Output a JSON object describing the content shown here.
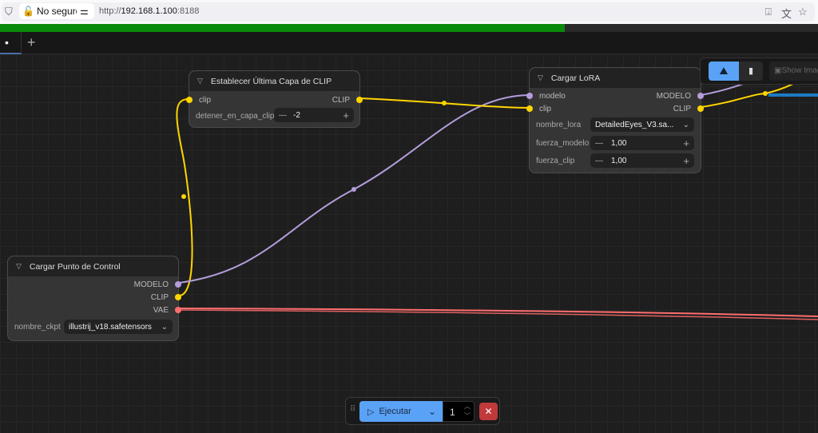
{
  "browser": {
    "security_label": "No seguro",
    "url_prefix": "http://",
    "url_host": "192.168.1.100",
    "url_port": ":8188"
  },
  "progress": {
    "percent": 69
  },
  "tabs": {
    "active_label": "•",
    "add_label": "+"
  },
  "nodes": {
    "clip_layer": {
      "title": "Establecer Última Capa de CLIP",
      "input": "clip",
      "output": "CLIP",
      "widget_label": "detener_en_capa_clip",
      "widget_value": "-2"
    },
    "lora": {
      "title": "Cargar LoRA",
      "inputs": [
        "modelo",
        "clip"
      ],
      "outputs": [
        "MODELO",
        "CLIP"
      ],
      "lora_label": "nombre_lora",
      "lora_value": "DetailedEyes_V3.sa...",
      "model_label": "fuerza_modelo",
      "model_value": "1,00",
      "clip_label": "fuerza_clip",
      "clip_value": "1,00"
    },
    "checkpoint": {
      "title": "Cargar Punto de Control",
      "outputs": [
        "MODELO",
        "CLIP",
        "VAE"
      ],
      "ckpt_label": "nombre_ckpt",
      "ckpt_value": "illustrij_v18.safetensors"
    }
  },
  "top_toolbar": {
    "show_image_label": "Show Image"
  },
  "run_bar": {
    "run_label": "Ejecutar",
    "batch_count": "1"
  },
  "colors": {
    "model": "#b39ddb",
    "clip": "#ffd500",
    "vae": "#ff6e6e",
    "accent": "#5aa2f5"
  }
}
